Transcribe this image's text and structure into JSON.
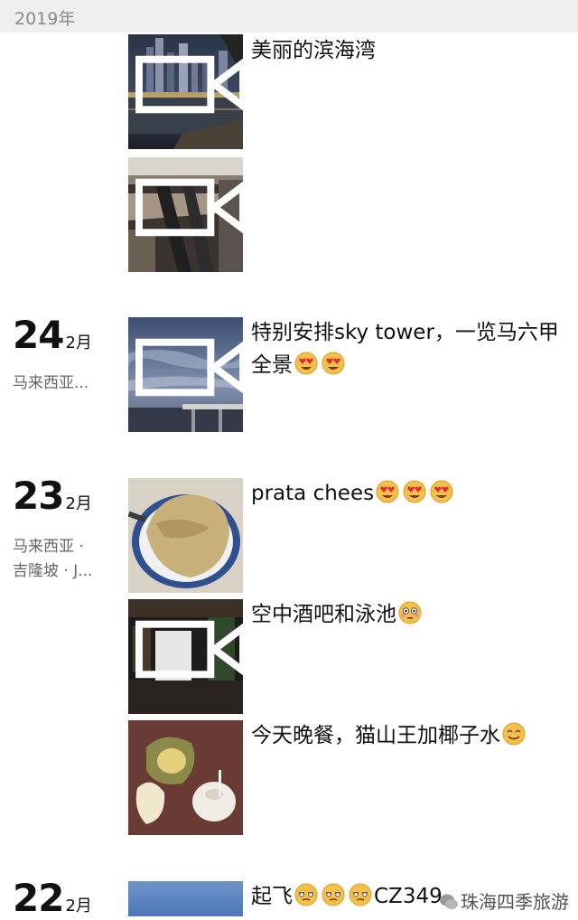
{
  "header": {
    "year": "2019年"
  },
  "days": [
    {
      "num": "24",
      "month": "2月",
      "location": "马来西亚...",
      "location2": ""
    },
    {
      "num": "23",
      "month": "2月",
      "location": "马来西亚 ·",
      "location2": "吉隆坡 · J..."
    },
    {
      "num": "22",
      "month": "2月",
      "location": "",
      "location2": ""
    }
  ],
  "posts": [
    {
      "caption": "美丽的滨海湾",
      "thumb_icon": "city-night-skyline-image",
      "video": true
    },
    {
      "caption": "",
      "thumb_icon": "mall-escalator-image",
      "video": true
    },
    {
      "caption": "特别安排sky tower，一览马六甲全景",
      "thumb_icon": "sky-tower-view-image",
      "video": true,
      "emojis": [
        "heart-eyes-emoji",
        "heart-eyes-emoji"
      ]
    },
    {
      "caption": "prata chees",
      "thumb_icon": "prata-plate-image",
      "video": false,
      "emojis": [
        "heart-eyes-emoji",
        "heart-eyes-emoji",
        "heart-eyes-emoji"
      ]
    },
    {
      "caption": "空中酒吧和泳池",
      "thumb_icon": "sky-bar-pool-image",
      "video": true,
      "emojis": [
        "flushed-emoji"
      ]
    },
    {
      "caption": "今天晚餐，猫山王加椰子水",
      "thumb_icon": "durian-coconut-image",
      "video": false,
      "emojis": [
        "smile-emoji"
      ]
    },
    {
      "caption": "起飞",
      "caption_tail": "CZ349",
      "thumb_icon": "sky-photo-image",
      "video": false,
      "emojis": [
        "sleepy-emoji",
        "sleepy-emoji",
        "sleepy-emoji"
      ]
    }
  ],
  "watermark": {
    "text": "珠海四季旅游",
    "icon": "wechat-icon"
  }
}
